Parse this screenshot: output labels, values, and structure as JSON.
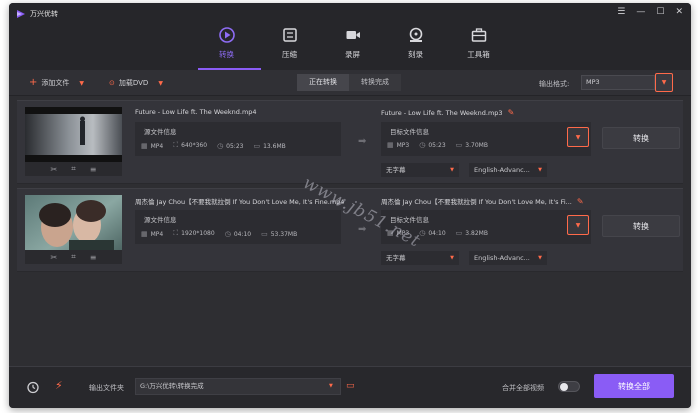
{
  "app": {
    "name": "万兴优转"
  },
  "window_controls": {
    "menu": "☰",
    "minimize": "—",
    "maximize": "☐",
    "close": "✕"
  },
  "nav": {
    "tabs": [
      {
        "label": "转换",
        "icon": "convert-icon",
        "active": true
      },
      {
        "label": "压缩",
        "icon": "compress-icon",
        "active": false
      },
      {
        "label": "录屏",
        "icon": "record-icon",
        "active": false
      },
      {
        "label": "刻录",
        "icon": "burn-icon",
        "active": false
      },
      {
        "label": "工具箱",
        "icon": "toolbox-icon",
        "active": false
      }
    ]
  },
  "toolbar": {
    "add_files": "添加文件",
    "load_dvd": "加载DVD",
    "tab_converting": "正在转换",
    "tab_done": "转换完成",
    "output_format_label": "输出格式:",
    "output_format_value": "MP3"
  },
  "items": [
    {
      "source_name": "Future - Low Life ft. The Weeknd.mp4",
      "source_box_title": "源文件信息",
      "source_format": "MP4",
      "source_resolution": "640*360",
      "source_duration": "05:23",
      "source_size": "13.6MB",
      "target_name": "Future - Low Life ft. The Weeknd.mp3",
      "target_box_title": "目标文件信息",
      "target_format": "MP3",
      "target_duration": "05:23",
      "target_size": "3.70MB",
      "subtitle": "无字幕",
      "audio": "English-Advanc...",
      "convert_label": "转换"
    },
    {
      "source_name": "周杰倫 Jay Chou【不要我就拉倒 If You Don't Love Me, It's Fine.mp4",
      "source_box_title": "源文件信息",
      "source_format": "MP4",
      "source_resolution": "1920*1080",
      "source_duration": "04:10",
      "source_size": "53.37MB",
      "target_name": "周杰倫 Jay Chou【不要我就拉倒 If You Don't Love Me, It's Fi...",
      "target_box_title": "目标文件信息",
      "target_format": "MP3",
      "target_duration": "04:10",
      "target_size": "3.82MB",
      "subtitle": "无字幕",
      "audio": "English-Advanc...",
      "convert_label": "转换"
    }
  ],
  "watermark": "www.jb51.net",
  "bottom": {
    "output_folder_label": "输出文件夹",
    "output_folder_path": "G:\\万兴优转\\转换完成",
    "merge_label": "合并全部视频",
    "merge_enabled": false,
    "convert_all": "转换全部"
  },
  "colors": {
    "accent": "#8a5cf5",
    "highlight": "#ff6a4a",
    "background": "#2e2e32"
  }
}
